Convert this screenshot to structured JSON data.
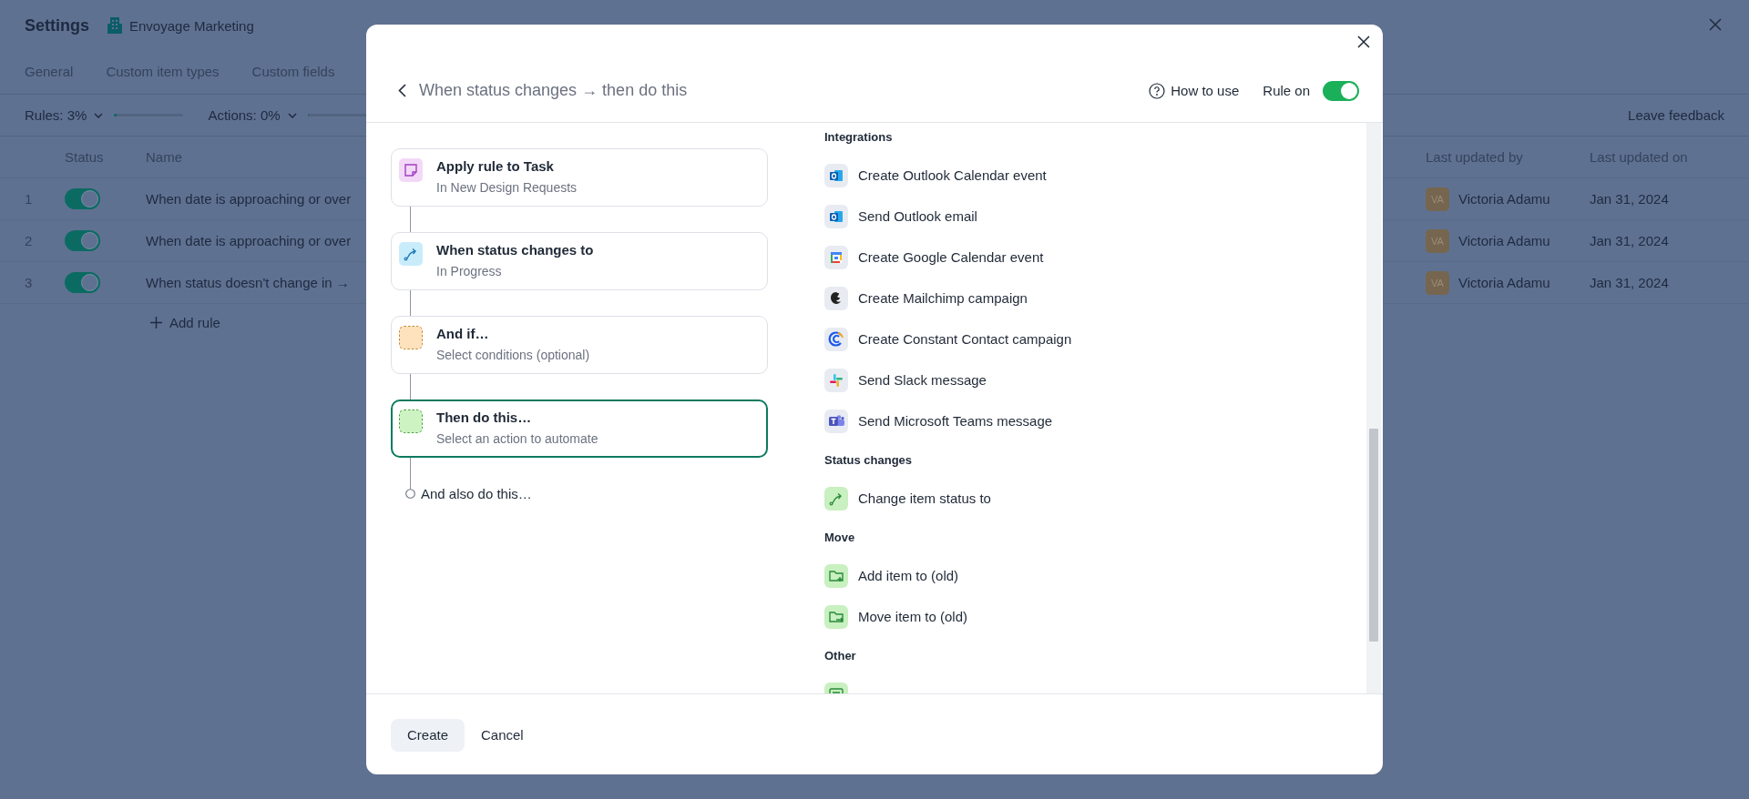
{
  "page": {
    "title": "Settings",
    "workspace": "Envoyage Marketing"
  },
  "tabs": [
    {
      "label": "General",
      "selected": false
    },
    {
      "label": "Custom item types",
      "selected": false
    },
    {
      "label": "Custom fields",
      "selected": false
    }
  ],
  "usage": [
    {
      "label": "Rules: 3%",
      "level": 0.03
    },
    {
      "label": "Actions: 0%",
      "level": 0
    }
  ],
  "feedback_link": "Leave feedback",
  "table": {
    "columns": [
      "Status",
      "Name",
      "Last updated by",
      "Last updated on"
    ],
    "rows": [
      {
        "number": "1",
        "on": true,
        "name": "When date is approaching or over",
        "avatar": "VA",
        "updated_by": "Victoria Adamu",
        "updated_on": "Jan 31, 2024"
      },
      {
        "number": "2",
        "on": true,
        "name": "When date is approaching or over",
        "avatar": "VA",
        "updated_by": "Victoria Adamu",
        "updated_on": "Jan 31, 2024"
      },
      {
        "number": "3",
        "on": true,
        "name": "When status doesn't change in →",
        "avatar": "VA",
        "updated_by": "Victoria Adamu",
        "updated_on": "Jan 31, 2024"
      }
    ]
  },
  "add_rule": "Add rule",
  "modal": {
    "title": "When status changes → then do this",
    "help": "How to use",
    "rule_toggle": {
      "label": "Rule on",
      "on": true
    },
    "steps": [
      {
        "kind": "task",
        "title": "Apply rule to Task",
        "subtitle": "In New Design Requests",
        "selected": false
      },
      {
        "kind": "status",
        "title": "When status changes to",
        "subtitle": "In Progress",
        "selected": false
      },
      {
        "kind": "condition",
        "title": "And if…",
        "subtitle": "Select conditions (optional)",
        "selected": false
      },
      {
        "kind": "action",
        "title": "Then do this…",
        "subtitle": "Select an action to automate",
        "selected": true
      }
    ],
    "also": "And also do this…",
    "sections": [
      {
        "title": "Integrations",
        "items": [
          {
            "kind": "outlook",
            "label": "Create Outlook Calendar event"
          },
          {
            "kind": "outlook",
            "label": "Send Outlook email"
          },
          {
            "kind": "gcal",
            "label": "Create Google Calendar event"
          },
          {
            "kind": "mailchimp",
            "label": "Create Mailchimp campaign"
          },
          {
            "kind": "constant",
            "label": "Create Constant Contact campaign"
          },
          {
            "kind": "slack",
            "label": "Send Slack message"
          },
          {
            "kind": "teams",
            "label": "Send Microsoft Teams message"
          }
        ]
      },
      {
        "title": "Status changes",
        "items": [
          {
            "kind": "status",
            "label": "Change item status to"
          }
        ]
      },
      {
        "title": "Move",
        "items": [
          {
            "kind": "folder_add",
            "label": "Add item to (old)"
          },
          {
            "kind": "folder_move",
            "label": "Move item to (old)"
          }
        ]
      },
      {
        "title": "Other",
        "items": [
          {
            "kind": "comment"
          }
        ]
      }
    ],
    "buttons": [
      {
        "kind": "primary",
        "label": "Create"
      },
      {
        "kind": "plain",
        "label": "Cancel"
      }
    ]
  }
}
